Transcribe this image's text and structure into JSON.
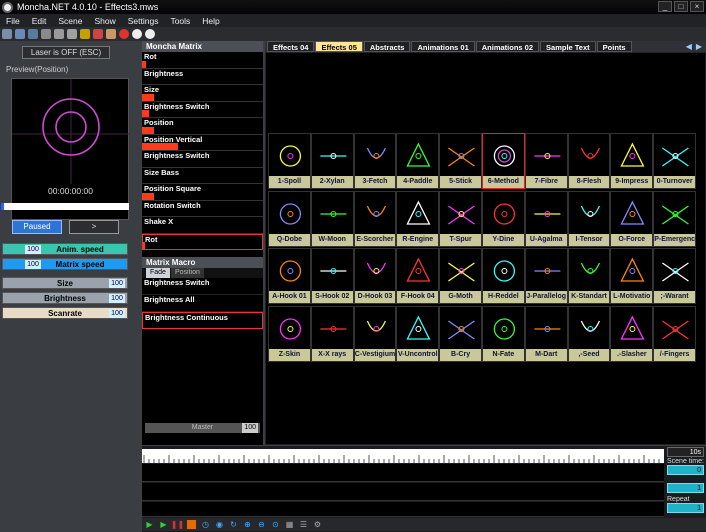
{
  "window": {
    "title": "Moncha.NET 4.0.10 - Effects3.mws"
  },
  "menu": [
    "File",
    "Edit",
    "Scene",
    "Show",
    "Settings",
    "Tools",
    "Help"
  ],
  "left": {
    "laser_button": "Laser is OFF (ESC)",
    "preview_label": "Preview(Position)",
    "timecode": "00:00:00:00",
    "paused_label": "Paused",
    "next_label": ">",
    "sliders": [
      {
        "label": "Anim. speed",
        "value": "100",
        "color": "#39c6b0"
      },
      {
        "label": "Matrix speed",
        "value": "100",
        "color": "#1e9bf0"
      },
      {
        "label": "Size",
        "value": "100",
        "color": "#9aa3ad"
      },
      {
        "label": "Brightness",
        "value": "100",
        "color": "#9aa3ad"
      },
      {
        "label": "Scanrate",
        "value": "100",
        "color": "#e8dcc6"
      }
    ]
  },
  "matrix": {
    "title": "Moncha Matrix",
    "rows": [
      {
        "label": "Rot",
        "fill": 0.03
      },
      {
        "label": "Brightness",
        "fill": 0
      },
      {
        "label": "Size",
        "fill": 0.1
      },
      {
        "label": "Brightness Switch",
        "fill": 0.06
      },
      {
        "label": "Position",
        "fill": 0.1
      },
      {
        "label": "Position Vertical",
        "fill": 0.3
      },
      {
        "label": "Brightness Switch",
        "fill": 0
      },
      {
        "label": "Size Bass",
        "fill": 0
      },
      {
        "label": "Position Square",
        "fill": 0.1
      },
      {
        "label": "Rotation Switch",
        "fill": 0
      },
      {
        "label": "Shake X",
        "fill": 0
      },
      {
        "label": "Rot",
        "fill": 0.02
      }
    ]
  },
  "macro": {
    "title": "Matrix Macro",
    "tabs": [
      "Fade",
      "Position"
    ],
    "rows": [
      "Brightness Switch",
      "Brightness All",
      "Brightness Continuous"
    ],
    "master_label": "Master",
    "master_value": "100"
  },
  "tabs": [
    "Effects 04",
    "Effects 05",
    "Abstracts",
    "Animations 01",
    "Animations 02",
    "Sample Text",
    "Points"
  ],
  "active_tab": "Effects 05",
  "effects": [
    "1-Spoll",
    "2-Xylan",
    "3-Fetch",
    "4-Paddle",
    "5-Stick",
    "6-Method",
    "7-Fibre",
    "8-Flesh",
    "9-Impress",
    "0-Turnover",
    "Q-Dobe",
    "W-Moon",
    "E-Scorcher",
    "R-Engine",
    "T-Spur",
    "Y-Dine",
    "U-Agalma",
    "I-Tensor",
    "O-Force",
    "P-Emergenc",
    "A-Hook 01",
    "S-Hook 02",
    "D-Hook 03",
    "F-Hook 04",
    "G-Moth",
    "H-Reddel",
    "J-Parallelog",
    "K-Standart",
    "L-Motivatio",
    ";-Warant",
    "Z-Skin",
    "X-X rays",
    "C-Vestigium",
    "V-Uncontrol",
    "B-Cry",
    "N-Fate",
    "M-Dart",
    ",-Seed",
    ".-Slasher",
    "/-Fingers"
  ],
  "bottom": {
    "scene_time_label": "Scene time:",
    "time_value": "10s",
    "repeat_label": "Repeat",
    "value_a": "0",
    "value_b": "1",
    "value_c": "1"
  }
}
